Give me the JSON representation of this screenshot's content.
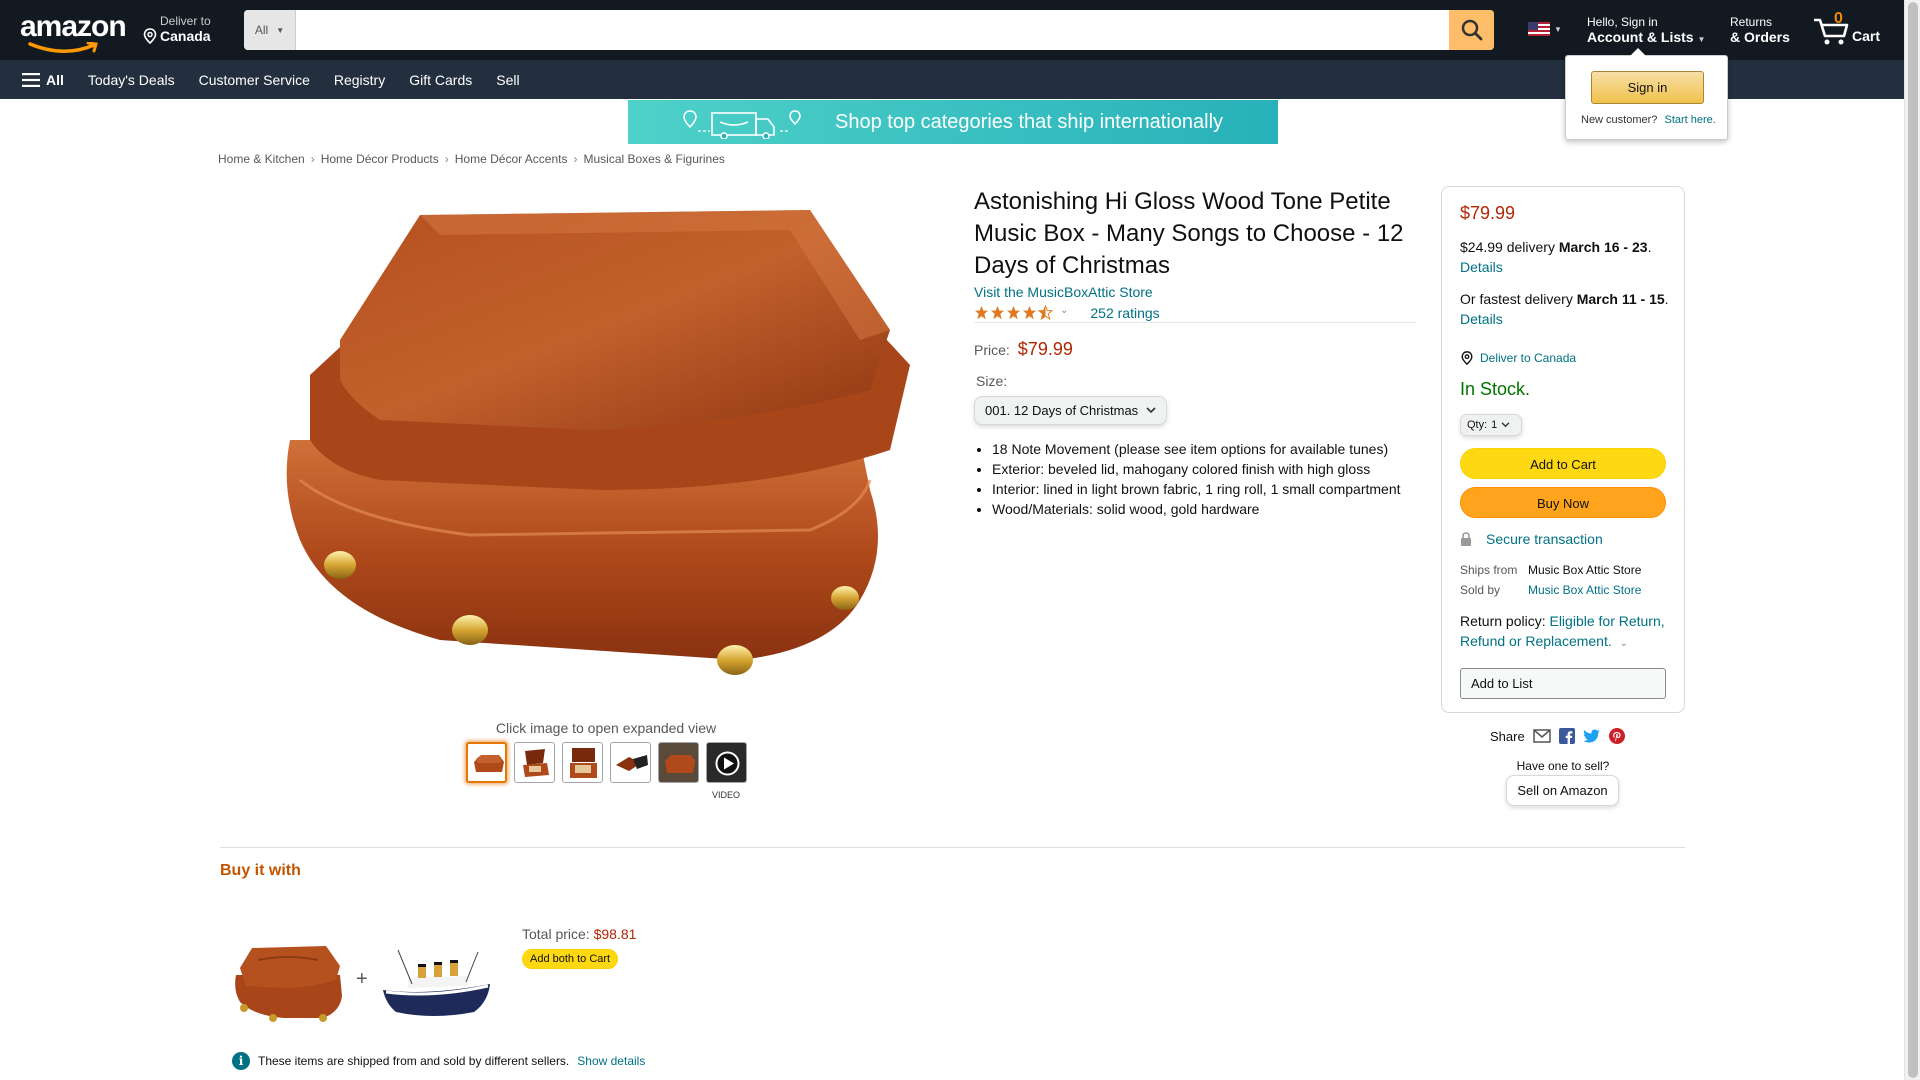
{
  "colors": {
    "nav_dark": "#131921",
    "nav_secondary": "#232f3e",
    "search_button": "#febd69",
    "price_red": "#b12704",
    "link_teal": "#007185",
    "stock_green": "#007600",
    "add_to_cart": "#ffd814",
    "buy_now": "#ffa41c",
    "section_orange": "#c45500"
  },
  "header": {
    "logo": "amazon",
    "deliver_to_label": "Deliver to",
    "deliver_to_location": "Canada",
    "search_category": "All",
    "search_value": "",
    "account_greeting": "Hello, Sign in",
    "account_label": "Account & Lists",
    "returns_label": "Returns",
    "orders_label": "& Orders",
    "cart_count": "0",
    "cart_label": "Cart"
  },
  "nav": {
    "all_label": "All",
    "links": [
      "Today's Deals",
      "Customer Service",
      "Registry",
      "Gift Cards",
      "Sell"
    ]
  },
  "signin_flyout": {
    "button": "Sign in",
    "new_customer": "New customer?",
    "start_here": "Start here."
  },
  "banner": {
    "text": "Shop top categories that ship internationally"
  },
  "breadcrumb": [
    "Home & Kitchen",
    "Home Décor Products",
    "Home Décor Accents",
    "Musical Boxes & Figurines"
  ],
  "gallery": {
    "hint": "Click image to open expanded view",
    "video_label": "VIDEO"
  },
  "product": {
    "title": "Astonishing Hi Gloss Wood Tone Petite Music Box - Many Songs to Choose - 12 Days of Christmas",
    "store_link": "Visit the MusicBoxAttic Store",
    "rating": 4.5,
    "ratings_count": "252 ratings",
    "price_label": "Price:",
    "price": "$79.99",
    "size_label": "Size:",
    "size_selected": "001. 12 Days of Christmas",
    "bullets": [
      "18 Note Movement (please see item options for available tunes)",
      "Exterior: beveled lid, mahogany colored finish with high gloss",
      "Interior: lined in light brown fabric, 1 ring roll, 1 small compartment",
      "Wood/Materials: solid wood, gold hardware"
    ]
  },
  "buybox": {
    "price": "$79.99",
    "delivery_cost": "$24.99 delivery",
    "delivery_dates": "March 16 - 23",
    "details_link": "Details",
    "fastest_prefix": "Or fastest delivery",
    "fastest_dates": "March 11 - 15",
    "deliver_to": "Deliver to Canada",
    "stock": "In Stock.",
    "qty_label": "Qty:",
    "qty_value": "1",
    "add_to_cart": "Add to Cart",
    "buy_now": "Buy Now",
    "secure": "Secure transaction",
    "ships_from_label": "Ships from",
    "ships_from_value": "Music Box Attic Store",
    "sold_by_label": "Sold by",
    "sold_by_value": "Music Box Attic Store",
    "return_label": "Return policy:",
    "return_value": "Eligible for Return, Refund or Replacement.",
    "add_to_list": "Add to List"
  },
  "share": {
    "label": "Share",
    "have_one": "Have one to sell?",
    "sell_button": "Sell on Amazon"
  },
  "buy_it_with": {
    "title": "Buy it with",
    "total_label": "Total price:",
    "total_value": "$98.81",
    "add_both": "Add both to Cart",
    "note": "These items are shipped from and sold by different sellers.",
    "show_details": "Show details"
  }
}
